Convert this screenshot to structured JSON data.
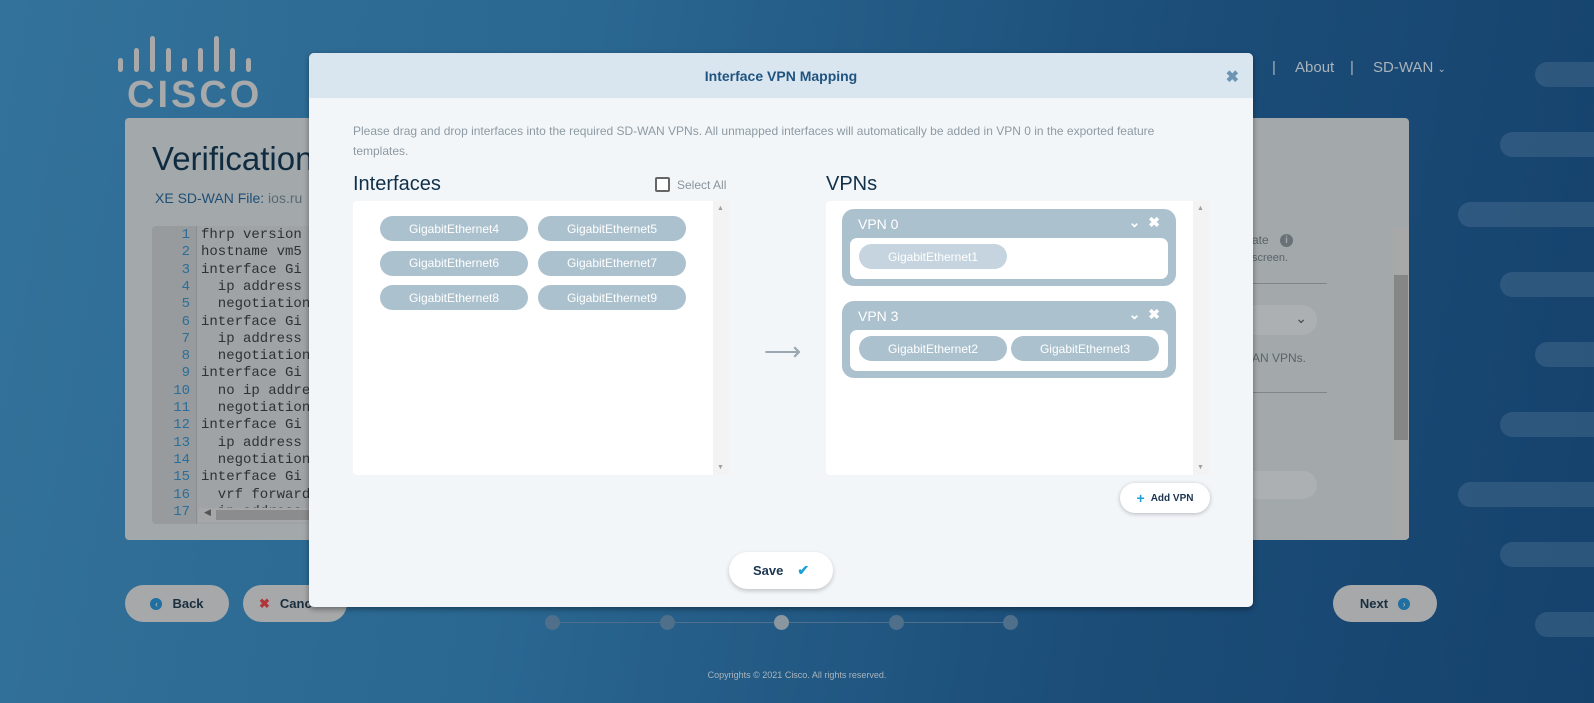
{
  "brand": {
    "logo_text": "CISCO"
  },
  "nav": {
    "about": "About",
    "sdwan": "SD-WAN",
    "separator": "|"
  },
  "page": {
    "title": "Verification",
    "file_label": "XE SD-WAN File:",
    "file_name": "ios.ru",
    "code_lines": [
      "fhrp version",
      "hostname vm5",
      "interface Gi",
      "  ip address",
      "  negotiation",
      "interface Gi",
      "  ip address",
      "  negotiation",
      "interface Gi",
      "  no ip addre",
      "  negotiation",
      "interface Gi",
      "  ip address",
      "  negotiation",
      "interface Gi",
      "  vrf forward",
      "  ip address"
    ],
    "right_fragments": [
      "ate",
      "screen.",
      "AN VPNs."
    ],
    "back": "Back",
    "cancel": "Canc",
    "next": "Next",
    "steps": {
      "count": 5,
      "active": 3
    },
    "copyright": "Copyrights © 2021 Cisco. All rights reserved."
  },
  "modal": {
    "title": "Interface VPN Mapping",
    "instructions": "Please drag and drop interfaces into the required SD-WAN VPNs. All unmapped interfaces will automatically be added in VPN 0 in the exported feature templates.",
    "interfaces_title": "Interfaces",
    "select_all": "Select All",
    "interfaces": [
      "GigabitEthernet4",
      "GigabitEthernet5",
      "GigabitEthernet6",
      "GigabitEthernet7",
      "GigabitEthernet8",
      "GigabitEthernet9"
    ],
    "vpns_title": "VPNs",
    "vpns": [
      {
        "name": "VPN 0",
        "interfaces": [
          "GigabitEthernet1"
        ]
      },
      {
        "name": "VPN 3",
        "interfaces": [
          "GigabitEthernet2",
          "GigabitEthernet3"
        ]
      }
    ],
    "add_vpn": "Add VPN",
    "save": "Save"
  },
  "colors": {
    "accent": "#1f5480",
    "chip": "#abc1ce",
    "check": "#1ba0d7"
  }
}
